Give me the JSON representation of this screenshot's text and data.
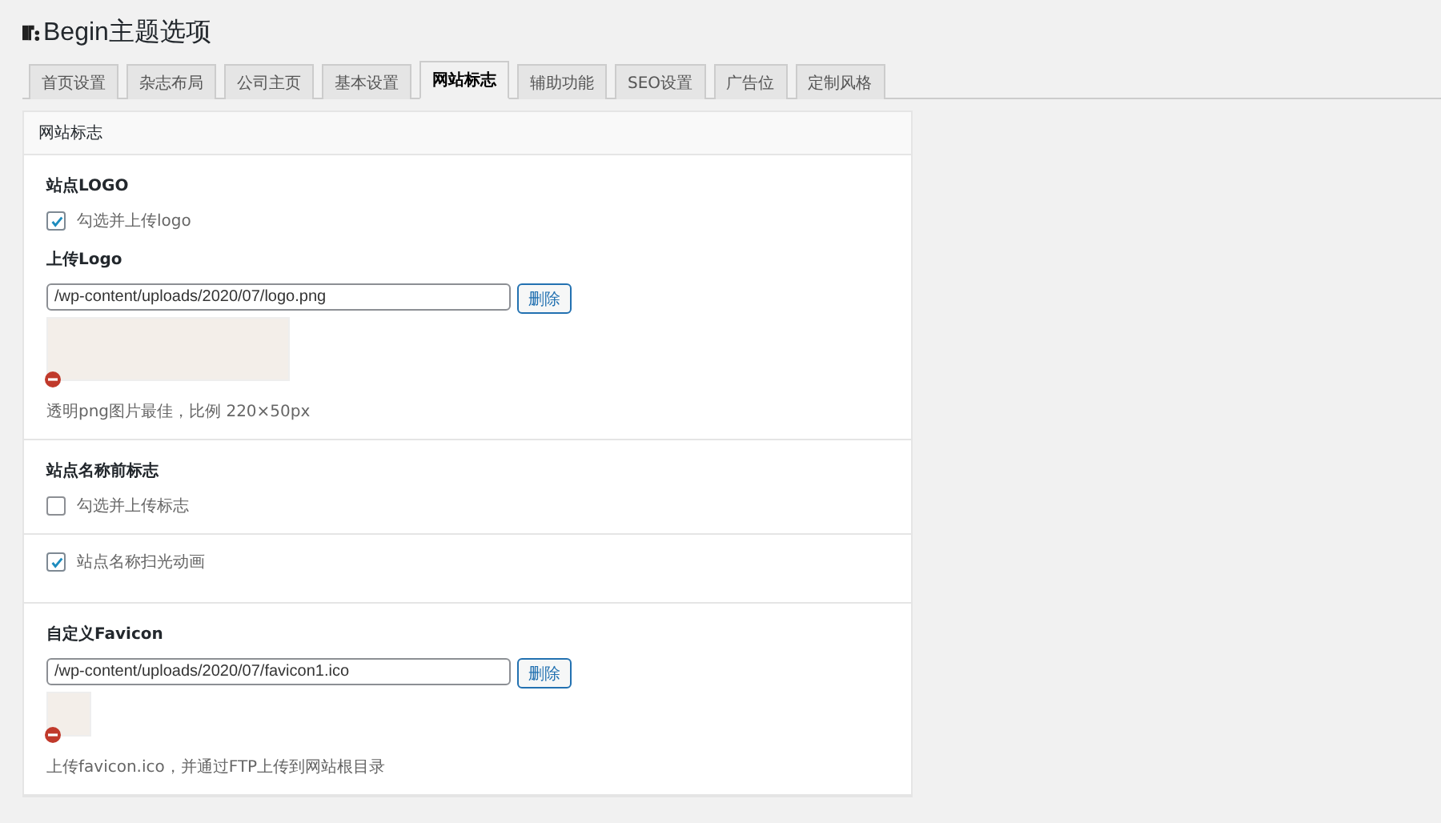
{
  "page_title": "Begin主题选项",
  "tabs": [
    {
      "label": "首页设置",
      "selected": false
    },
    {
      "label": "杂志布局",
      "selected": false
    },
    {
      "label": "公司主页",
      "selected": false
    },
    {
      "label": "基本设置",
      "selected": false
    },
    {
      "label": "网站标志",
      "selected": true
    },
    {
      "label": "辅助功能",
      "selected": false
    },
    {
      "label": "SEO设置",
      "selected": false
    },
    {
      "label": "广告位",
      "selected": false
    },
    {
      "label": "定制风格",
      "selected": false
    }
  ],
  "panel": {
    "title": "网站标志",
    "blocks": [
      {
        "items": [
          {
            "kind": "heading",
            "text": "站点LOGO"
          },
          {
            "kind": "checkbox",
            "label": "勾选并上传logo",
            "checked": true
          },
          {
            "kind": "heading",
            "text": "上传Logo"
          },
          {
            "kind": "logo_upload",
            "value": "/wp-content/uploads/2020/07/logo.png",
            "button": "删除"
          },
          {
            "kind": "help",
            "text": "透明png图片最佳，比例 220×50px"
          }
        ]
      },
      {
        "items": [
          {
            "kind": "heading",
            "text": "站点名称前标志"
          },
          {
            "kind": "checkbox",
            "label": "勾选并上传标志",
            "checked": false
          }
        ]
      },
      {
        "items": [
          {
            "kind": "checkbox",
            "label": "站点名称扫光动画",
            "checked": true
          }
        ]
      },
      {
        "items": [
          {
            "kind": "heading",
            "text": "自定义Favicon"
          },
          {
            "kind": "favicon_upload",
            "value": "/wp-content/uploads/2020/07/favicon1.ico",
            "button": "删除"
          },
          {
            "kind": "help",
            "text": "上传favicon.ico，并通过FTP上传到网站根目录"
          }
        ]
      }
    ]
  }
}
